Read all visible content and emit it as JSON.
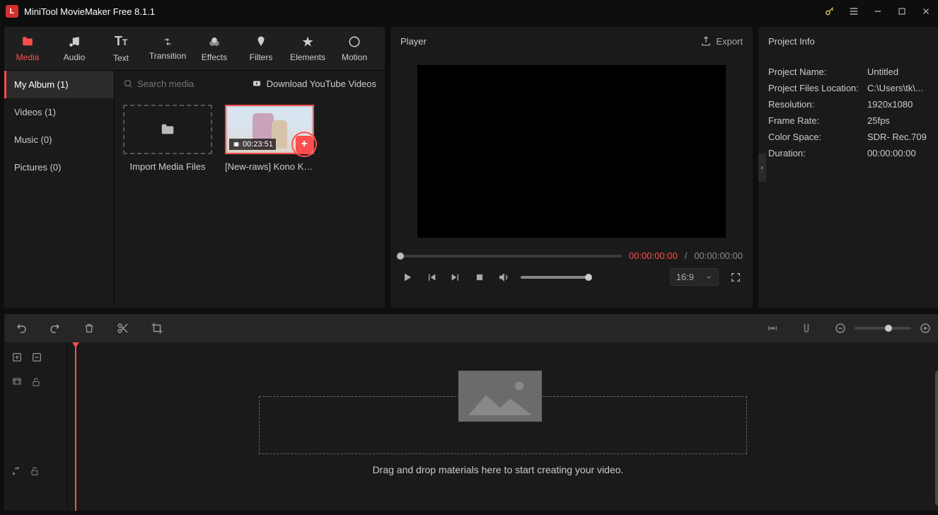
{
  "titlebar": {
    "app_title": "MiniTool MovieMaker Free 8.1.1"
  },
  "tabs": [
    {
      "id": "media",
      "label": "Media"
    },
    {
      "id": "audio",
      "label": "Audio"
    },
    {
      "id": "text",
      "label": "Text"
    },
    {
      "id": "transition",
      "label": "Transition"
    },
    {
      "id": "effects",
      "label": "Effects"
    },
    {
      "id": "filters",
      "label": "Filters"
    },
    {
      "id": "elements",
      "label": "Elements"
    },
    {
      "id": "motion",
      "label": "Motion"
    }
  ],
  "sidebar": {
    "items": [
      {
        "label": "My Album (1)"
      },
      {
        "label": "Videos (1)"
      },
      {
        "label": "Music (0)"
      },
      {
        "label": "Pictures (0)"
      }
    ]
  },
  "media_top": {
    "search_placeholder": "Search media",
    "youtube_label": "Download YouTube Videos"
  },
  "media_cards": {
    "import_label": "Import Media Files",
    "clip_duration": "00:23:51",
    "clip_name": "[New-raws] Kono Ka..."
  },
  "player": {
    "header": "Player",
    "export_label": "Export",
    "time_current": "00:00:00:00",
    "time_total": "00:00:00:00",
    "aspect": "16:9"
  },
  "project_info": {
    "header": "Project Info",
    "rows": [
      {
        "k": "Project Name:",
        "v": "Untitled"
      },
      {
        "k": "Project Files Location:",
        "v": "C:\\Users\\tk\\..."
      },
      {
        "k": "Resolution:",
        "v": "1920x1080"
      },
      {
        "k": "Frame Rate:",
        "v": "25fps"
      },
      {
        "k": "Color Space:",
        "v": "SDR- Rec.709"
      },
      {
        "k": "Duration:",
        "v": "00:00:00:00"
      }
    ]
  },
  "timeline": {
    "drop_text": "Drag and drop materials here to start creating your video."
  }
}
